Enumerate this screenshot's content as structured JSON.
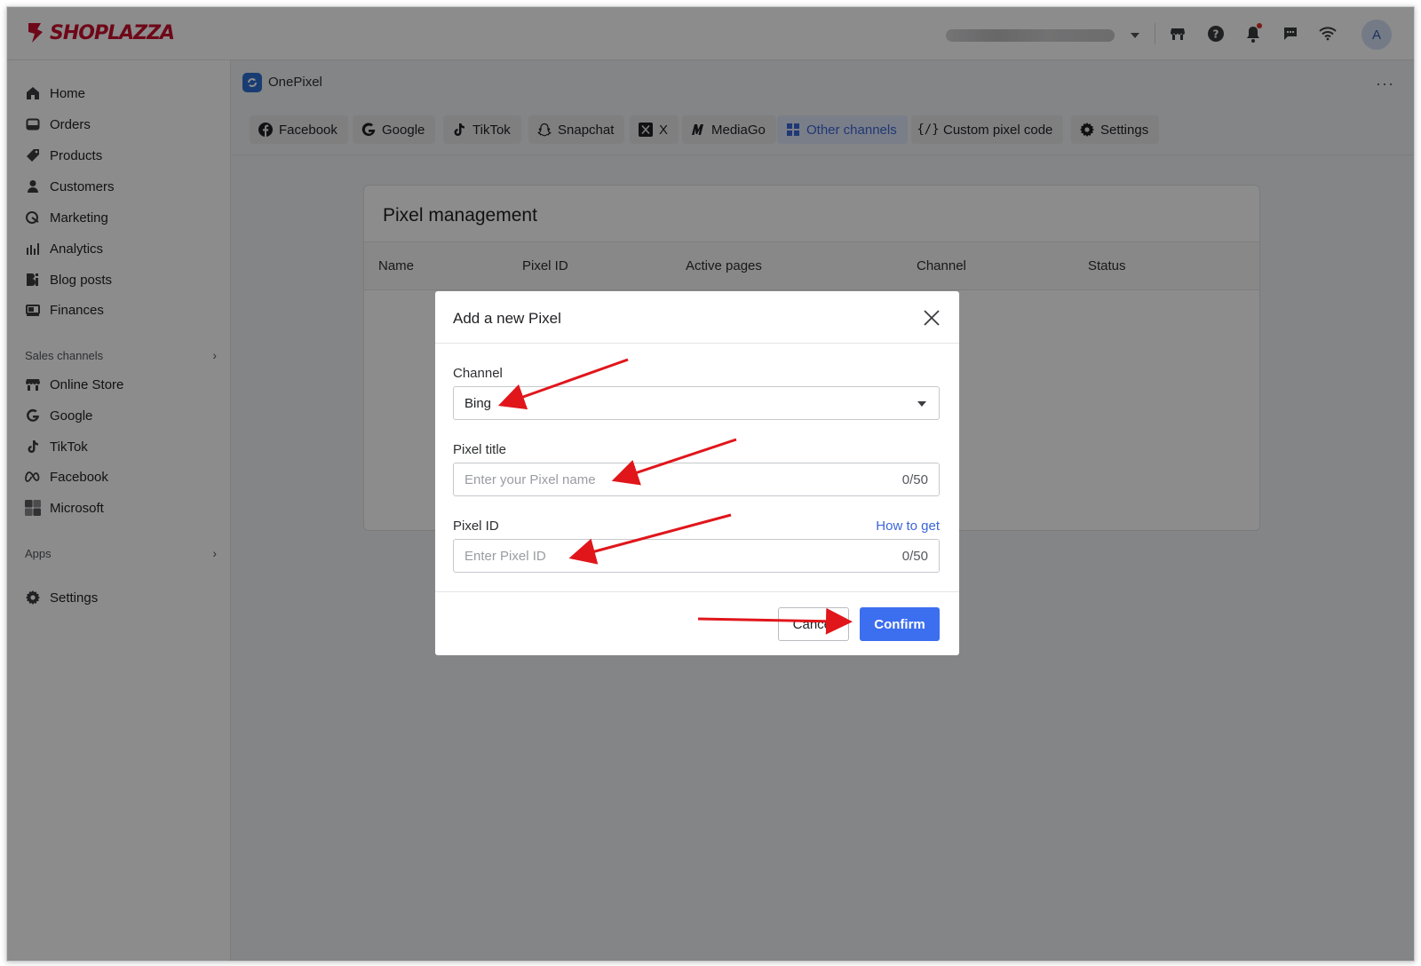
{
  "brand": {
    "name": "SHOPLAZZA",
    "color": "#c8102e"
  },
  "topbar": {
    "icons": [
      "store-icon",
      "help-icon",
      "bell-icon",
      "chat-icon",
      "wifi-icon"
    ],
    "avatar_initial": "A"
  },
  "sidebar": {
    "main_items": [
      {
        "label": "Home",
        "icon": "home-icon"
      },
      {
        "label": "Orders",
        "icon": "orders-icon"
      },
      {
        "label": "Products",
        "icon": "tag-icon"
      },
      {
        "label": "Customers",
        "icon": "person-icon"
      },
      {
        "label": "Marketing",
        "icon": "marketing-icon"
      },
      {
        "label": "Analytics",
        "icon": "analytics-icon"
      },
      {
        "label": "Blog posts",
        "icon": "blog-icon"
      },
      {
        "label": "Finances",
        "icon": "finances-icon"
      }
    ],
    "sales_channels_label": "Sales channels",
    "channel_items": [
      {
        "label": "Online Store",
        "icon": "store-icon"
      },
      {
        "label": "Google",
        "icon": "google-icon"
      },
      {
        "label": "TikTok",
        "icon": "tiktok-icon"
      },
      {
        "label": "Facebook",
        "icon": "meta-icon"
      },
      {
        "label": "Microsoft",
        "icon": "microsoft-icon"
      }
    ],
    "apps_label": "Apps",
    "settings_label": "Settings"
  },
  "app": {
    "title": "OnePixel",
    "more_label": "···",
    "tabs": [
      {
        "label": "Facebook",
        "icon": "facebook-icon"
      },
      {
        "label": "Google",
        "icon": "google-icon"
      },
      {
        "label": "TikTok",
        "icon": "tiktok-icon"
      },
      {
        "label": "Snapchat",
        "icon": "snapchat-icon"
      },
      {
        "label": "X",
        "icon": "x-icon"
      },
      {
        "label": "MediaGo",
        "icon": "mediago-icon"
      },
      {
        "label": "Other channels",
        "icon": "grid-icon",
        "active": true
      },
      {
        "label": "Custom pixel code",
        "icon": "code-icon"
      },
      {
        "label": "Settings",
        "icon": "gear-icon"
      }
    ]
  },
  "pixel_management": {
    "title": "Pixel management",
    "columns": [
      "Name",
      "Pixel ID",
      "Active pages",
      "Channel",
      "Status"
    ]
  },
  "modal": {
    "title": "Add a new Pixel",
    "channel_label": "Channel",
    "channel_value": "Bing",
    "pixel_title_label": "Pixel title",
    "pixel_title_placeholder": "Enter your Pixel name",
    "pixel_title_count": "0/50",
    "pixel_id_label": "Pixel ID",
    "pixel_id_placeholder": "Enter Pixel ID",
    "pixel_id_count": "0/50",
    "how_to_get": "How to get",
    "cancel_label": "Cancel",
    "confirm_label": "Confirm"
  },
  "colors": {
    "accent": "#3c6ef0",
    "annotation_arrow": "#e0161b"
  }
}
